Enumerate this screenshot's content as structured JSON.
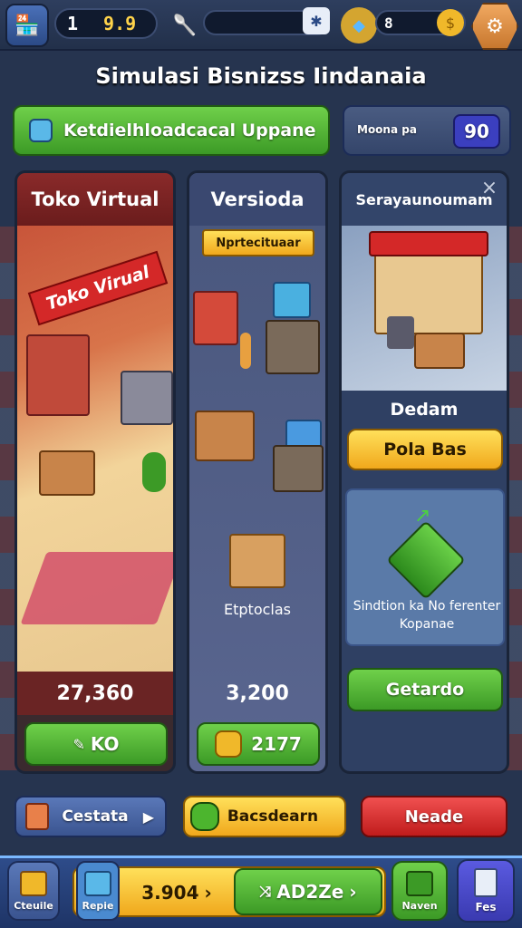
{
  "top": {
    "level": "1",
    "coins": "9.9",
    "gems": "8",
    "icons": [
      "shop-icon",
      "spatula-icon",
      "gear-icon",
      "gem-icon",
      "coin-icon",
      "settings-cog-icon"
    ]
  },
  "title": "Simulasi Bisnizss Iindanaia",
  "update_btn": "Ketdielhloadcacal Uppane",
  "mode_label": "Moona pa",
  "mode_value": "90",
  "panel1": {
    "title": "Toko Virtual",
    "sign": "Toko Virual",
    "value": "27,360",
    "btn": "KO"
  },
  "panel2": {
    "title": "Versioda",
    "badge": "Nprtecituaar",
    "label": "Etptoclas",
    "value": "3,200",
    "btn": "2177"
  },
  "panel3": {
    "title": "Serayaunoumam",
    "label": "Dedam",
    "btn1": "Pola Bas",
    "box_text": "Sindtion ka No ferenter Kopanae",
    "btn2": "Getardo",
    "close": "×"
  },
  "bottom_row": {
    "b1": "Cestata",
    "b2": "Bacsdearn",
    "b3": "Neade"
  },
  "nav": {
    "n1": "Cteuile",
    "n2": "Repie",
    "currency": "3.904",
    "action": "AD2Ze",
    "n3": "Naven",
    "n4": "Fes"
  },
  "colors": {
    "accent_green": "#4cb52e",
    "accent_yellow": "#f6c233",
    "accent_red": "#d62a2a",
    "panel_bg": "#2f4063"
  }
}
